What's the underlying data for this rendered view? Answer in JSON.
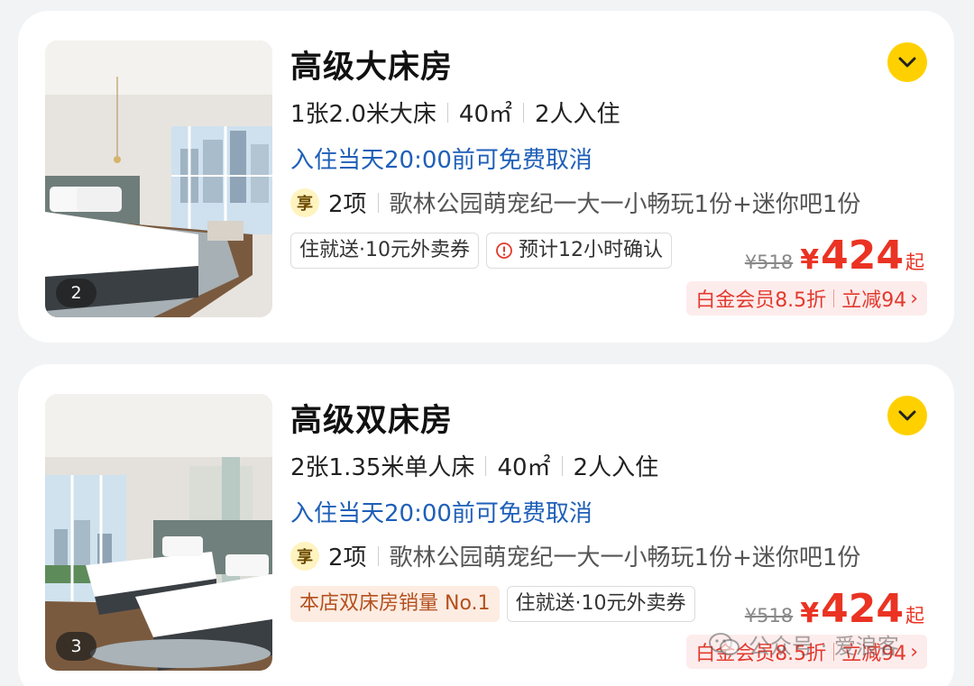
{
  "rooms": [
    {
      "title": "高级大床房",
      "bed": "1张2.0米大床",
      "area": "40㎡",
      "occupancy": "2人入住",
      "cancel_policy": "入住当天20:00前可免费取消",
      "perk_icon_text": "享",
      "perk_count": "2项",
      "perk_desc": "歌林公园萌宠纪一大一小畅玩1份+迷你吧1份",
      "tags": [
        "住就送·10元外卖券",
        "预计12小时确认"
      ],
      "photo_count": "2",
      "original_price": "¥518",
      "currency": "¥",
      "price": "424",
      "price_suffix": "起",
      "member_discount": "白金会员8.5折",
      "instant_discount": "立减94",
      "arrow": "›"
    },
    {
      "title": "高级双床房",
      "bed": "2张1.35米单人床",
      "area": "40㎡",
      "occupancy": "2人入住",
      "cancel_policy": "入住当天20:00前可免费取消",
      "perk_icon_text": "享",
      "perk_count": "2项",
      "perk_desc": "歌林公园萌宠纪一大一小畅玩1份+迷你吧1份",
      "tags": [
        "本店双床房销量 No.1",
        "住就送·10元外卖券"
      ],
      "photo_count": "3",
      "original_price": "¥518",
      "currency": "¥",
      "price": "424",
      "price_suffix": "起",
      "member_discount": "白金会员8.5折",
      "instant_discount": "立减94",
      "arrow": "›"
    }
  ],
  "watermark": {
    "text": "公众号 · 爱浪客",
    "icon": "wechat-icon"
  },
  "colors": {
    "accent_yellow": "#ffd000",
    "price_red": "#ea3323",
    "policy_blue": "#1f5fb8",
    "discount_bg": "#fdecec",
    "sales_tag_bg": "#fdece2"
  },
  "icons": {
    "expand": "chevron-down-icon",
    "perk": "perk-badge-icon",
    "confirm": "info-circle-icon"
  }
}
